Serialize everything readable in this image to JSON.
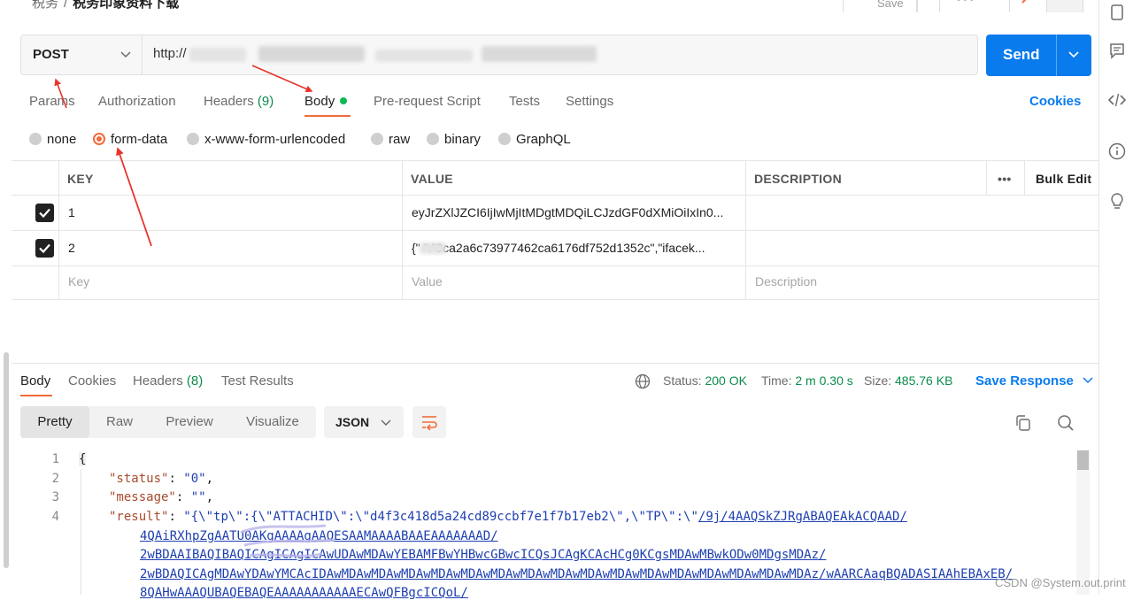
{
  "breadcrumb": {
    "parent": "税务",
    "current": "税务印象资料下载"
  },
  "top_actions": {
    "save_label": "Save"
  },
  "request": {
    "method": "POST",
    "url": "http://"
  },
  "send_label": "Send",
  "request_tabs": {
    "params": "Params",
    "authorization": "Authorization",
    "headers": "Headers",
    "headers_count": "(9)",
    "body": "Body",
    "pre_request": "Pre-request Script",
    "tests": "Tests",
    "settings": "Settings",
    "cookies": "Cookies"
  },
  "body_types": [
    "none",
    "form-data",
    "x-www-form-urlencoded",
    "raw",
    "binary",
    "GraphQL"
  ],
  "body_type_selected": "form-data",
  "params_table": {
    "headers": {
      "key": "KEY",
      "value": "VALUE",
      "description": "DESCRIPTION",
      "bulk_edit": "Bulk Edit",
      "more": "•••"
    },
    "rows": [
      {
        "checked": true,
        "key": "1",
        "value": "eyJrZXlJZCI6IjIwMjItMDgtMDQiLCJzdGF0dXMiOiIxIn0...",
        "description": ""
      },
      {
        "checked": true,
        "key": "2",
        "value": "{\"        \":\"3ca2a6c73977462ca6176df752d1352c\",\"ifacek...",
        "description": ""
      }
    ],
    "placeholders": {
      "key": "Key",
      "value": "Value",
      "description": "Description"
    }
  },
  "response_tabs": {
    "body": "Body",
    "cookies": "Cookies",
    "headers": "Headers",
    "headers_count": "(8)",
    "test_results": "Test Results"
  },
  "response_status": {
    "status_label": "Status:",
    "status_value": "200 OK",
    "time_label": "Time:",
    "time_value": "2 m 0.30 s",
    "size_label": "Size:",
    "size_value": "485.76 KB",
    "save_response": "Save Response"
  },
  "view_modes": {
    "pretty": "Pretty",
    "raw": "Raw",
    "preview": "Preview",
    "visualize": "Visualize",
    "format": "JSON"
  },
  "code": {
    "line_numbers": [
      "1",
      "2",
      "3",
      "4"
    ],
    "line1": "{",
    "status_key": "\"status\"",
    "status_val": "\"0\"",
    "message_key": "\"message\"",
    "message_val": "\"\"",
    "result_key": "\"result\"",
    "result_val_prefix": "\"{\\\"tp\\\":{\\\"ATTACHID\\\":\\\"d4f3c418d5a24cd89ccbf7e1f7b17eb2\\\",\\\"TP\\\":\\\"",
    "result_val_link1": "/9j/4AAQSkZJRgABAQEAkACQAAD/",
    "wrap2": "4QAiRXhpZgAATU0AKgAAAAgAAQESAAMAAAABAAEAAAAAAAD/",
    "wrap3": "2wBDAAIBAQIBAQICAgICAgICAwUDAwMDAwYEBAMFBwYHBwcGBwcICQsJCAgKCAcHCg0KCgsMDAwMBwkODw0MDgsMDAz/",
    "wrap4": "2wBDAQICAgMDAwYDAwYMCAcIDAwMDAwMDAwMDAwMDAwMDAwMDAwMDAwMDAwMDAwMDAwMDAwMDAwMDAwMDAwMDAwMDAz/wAARCAaqBQADASIAAhEBAxEB/",
    "wrap5": "8QAHwAAAQUBAQEBAQEAAAAAAAAAAAECAwQFBgcICQoL/"
  },
  "watermark": "CSDN @System.out.print",
  "colors": {
    "accent": "#097bed",
    "active_tab": "#f26b3a",
    "success": "#0c8c4a",
    "annotation": "#e8342c"
  }
}
